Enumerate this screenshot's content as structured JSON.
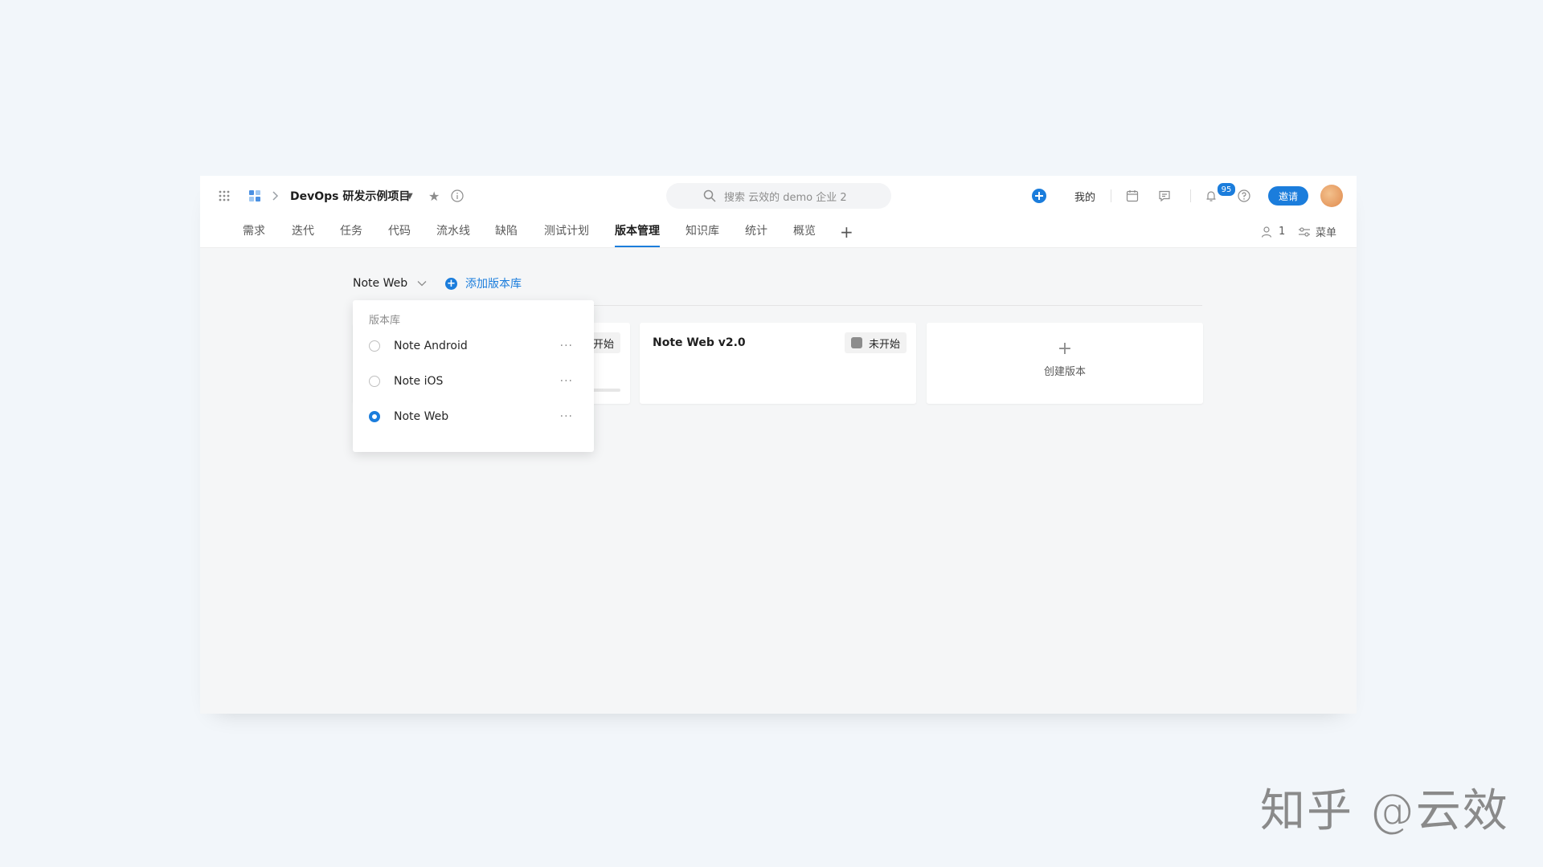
{
  "header": {
    "project_name": "DevOps 研发示例项目",
    "search_placeholder": "搜索 云效的 demo 企业 2",
    "mine_label": "我的",
    "notification_count": "95",
    "invite_label": "邀请"
  },
  "tabs": [
    {
      "label": "需求"
    },
    {
      "label": "迭代"
    },
    {
      "label": "任务"
    },
    {
      "label": "代码"
    },
    {
      "label": "流水线"
    },
    {
      "label": "缺陷"
    },
    {
      "label": "测试计划"
    },
    {
      "label": "版本管理",
      "active": true
    },
    {
      "label": "知识库"
    },
    {
      "label": "统计"
    },
    {
      "label": "概览"
    }
  ],
  "toolbar_right": {
    "member_count": "1",
    "menu_label": "菜单"
  },
  "library": {
    "current": "Note Web",
    "add_label": "添加版本库"
  },
  "dropdown": {
    "header": "版本库",
    "items": [
      {
        "label": "Note Android",
        "selected": false,
        "more": "···"
      },
      {
        "label": "Note iOS",
        "selected": false,
        "more": "···"
      },
      {
        "label": "Note Web",
        "selected": true,
        "more": "···"
      }
    ]
  },
  "cards": [
    {
      "title": "",
      "status": "开始"
    },
    {
      "title": "Note Web v2.0",
      "status": "未开始"
    }
  ],
  "create_card": {
    "label": "创建版本"
  },
  "watermark": "知乎 @云效",
  "colors": {
    "accent": "#1b7ddc",
    "page_bg": "#f2f6fa",
    "content_bg": "#f5f6f7"
  }
}
